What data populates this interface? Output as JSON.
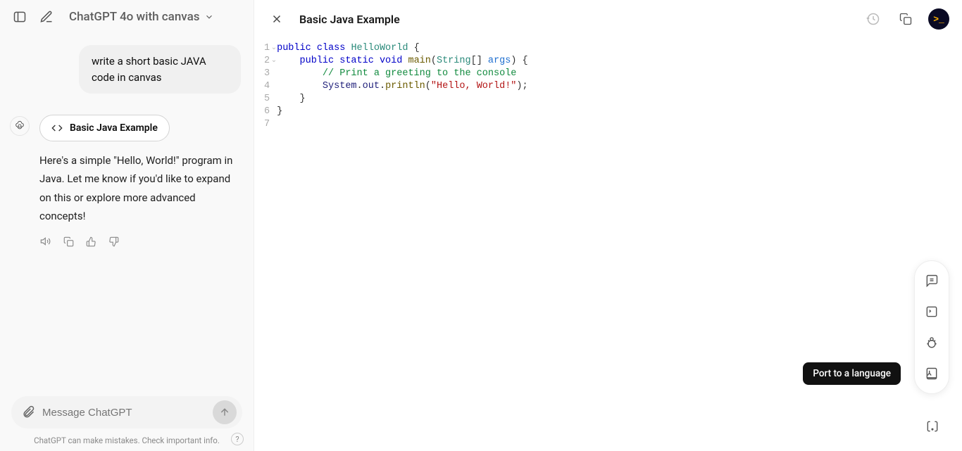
{
  "header": {
    "model_label": "ChatGPT 4o with canvas"
  },
  "chat": {
    "user_message": "write a short basic JAVA code in canvas",
    "artifact_label": "Basic Java Example",
    "assistant_message": "Here's a simple \"Hello, World!\" program in Java. Let me know if you'd like to expand on this or explore more advanced concepts!"
  },
  "input": {
    "placeholder": "Message ChatGPT"
  },
  "footer": {
    "disclaimer": "ChatGPT can make mistakes. Check important info.",
    "help_glyph": "?"
  },
  "canvas": {
    "title": "Basic Java Example",
    "line_numbers": [
      "1",
      "2",
      "3",
      "4",
      "5",
      "6",
      "7"
    ],
    "code": {
      "l1": {
        "k1": "public",
        "k2": "class",
        "cls": "HelloWorld",
        "open": " {"
      },
      "l2": {
        "pad": "    ",
        "k1": "public",
        "k2": "static",
        "k3": "void",
        "fn": "main",
        "paren1": "(",
        "type": "String",
        "arr": "[] ",
        "param": "args",
        "paren2": ")",
        "open": " {"
      },
      "l3": {
        "pad": "        ",
        "comment": "// Print a greeting to the console"
      },
      "l4": {
        "pad": "        ",
        "o1": "System",
        "dot1": ".",
        "o2": "out",
        "dot2": ".",
        "fn": "println",
        "paren1": "(",
        "str": "\"Hello, World!\"",
        "paren2": ");"
      },
      "l5": {
        "pad": "    ",
        "close": "}"
      },
      "l6": {
        "close": "}"
      }
    }
  },
  "tooltip": {
    "port": "Port to a language"
  },
  "profile_glyph": ">_"
}
